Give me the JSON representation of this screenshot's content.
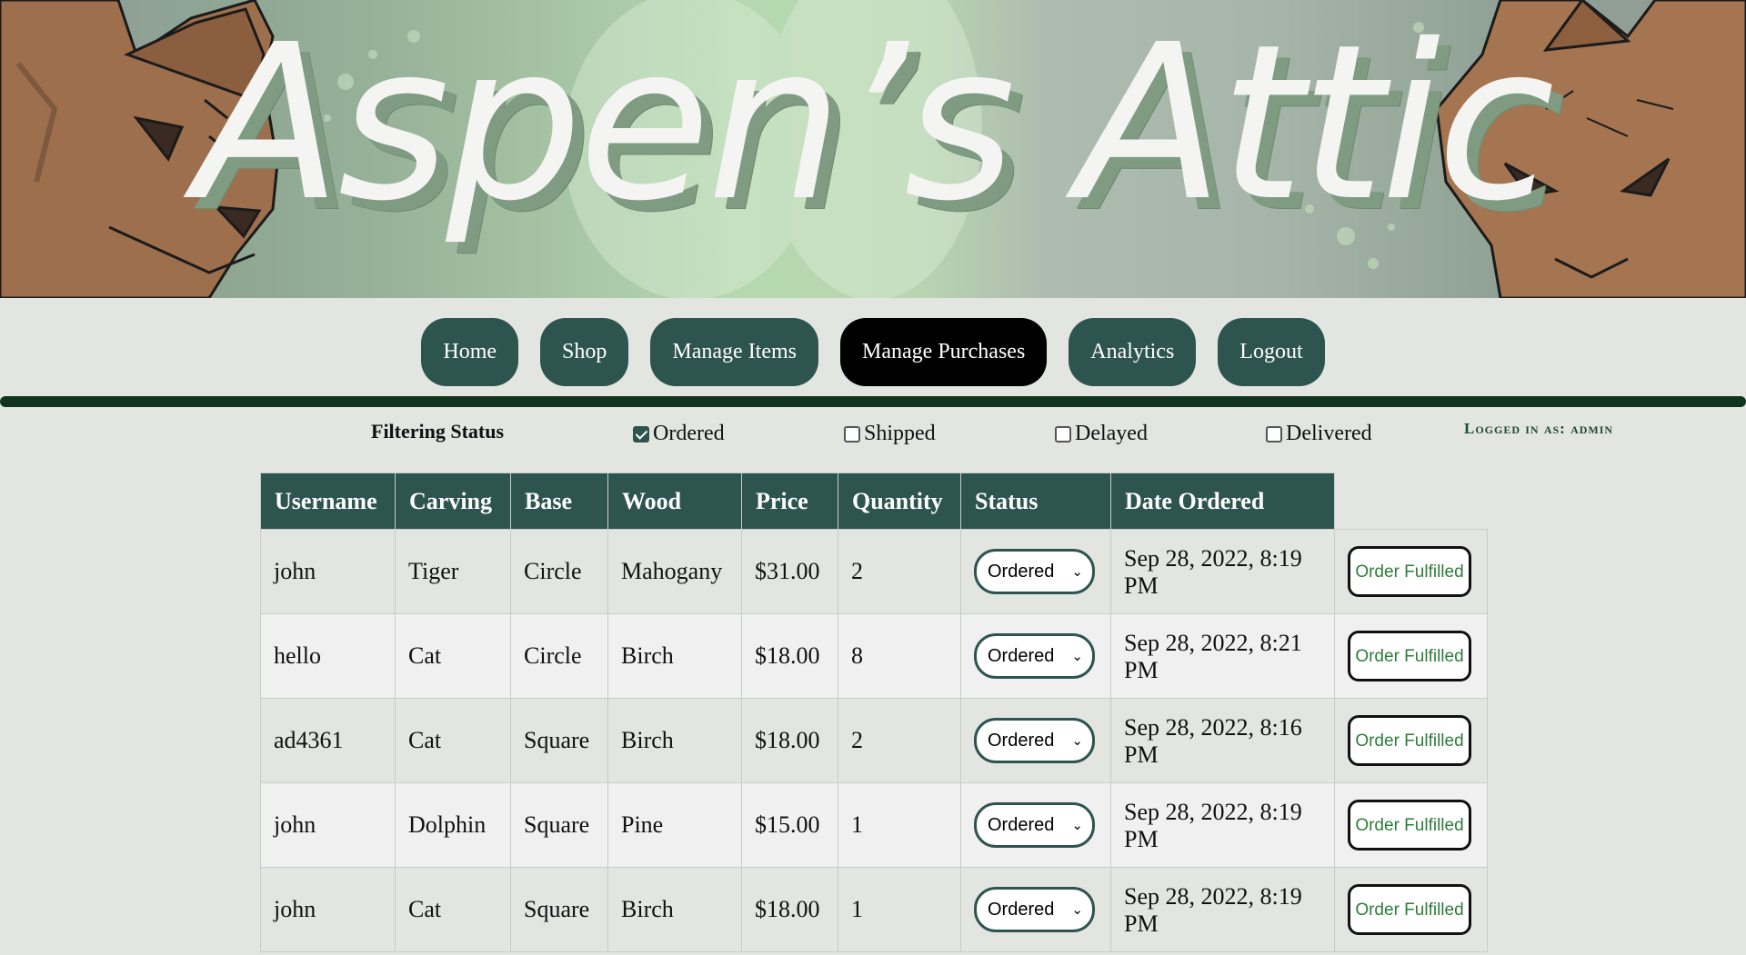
{
  "banner": {
    "title": "Aspen’s Attic"
  },
  "nav": {
    "items": [
      {
        "label": "Home"
      },
      {
        "label": "Shop"
      },
      {
        "label": "Manage Items"
      },
      {
        "label": "Manage Purchases",
        "active": true
      },
      {
        "label": "Analytics"
      },
      {
        "label": "Logout"
      }
    ]
  },
  "filter": {
    "label": "Filtering Status",
    "options": [
      {
        "label": "Ordered",
        "checked": true
      },
      {
        "label": "Shipped",
        "checked": false
      },
      {
        "label": "Delayed",
        "checked": false
      },
      {
        "label": "Delivered",
        "checked": false
      }
    ]
  },
  "user": {
    "logged_in": "Logged in as: admin"
  },
  "table": {
    "headers": [
      "Username",
      "Carving",
      "Base",
      "Wood",
      "Price",
      "Quantity",
      "Status",
      "Date Ordered"
    ],
    "action_label": "Order Fulfilled",
    "rows": [
      {
        "username": "john",
        "carving": "Tiger",
        "base": "Circle",
        "wood": "Mahogany",
        "price": "$31.00",
        "quantity": "2",
        "status": "Ordered",
        "date_line1": "Sep 28, 2022, 8:19",
        "date_line2": "PM"
      },
      {
        "username": "hello",
        "carving": "Cat",
        "base": "Circle",
        "wood": "Birch",
        "price": "$18.00",
        "quantity": "8",
        "status": "Ordered",
        "date_line1": "Sep 28, 2022, 8:21",
        "date_line2": "PM"
      },
      {
        "username": "ad4361",
        "carving": "Cat",
        "base": "Square",
        "wood": "Birch",
        "price": "$18.00",
        "quantity": "2",
        "status": "Ordered",
        "date_line1": "Sep 28, 2022, 8:16",
        "date_line2": "PM"
      },
      {
        "username": "john",
        "carving": "Dolphin",
        "base": "Square",
        "wood": "Pine",
        "price": "$15.00",
        "quantity": "1",
        "status": "Ordered",
        "date_line1": "Sep 28, 2022, 8:19",
        "date_line2": "PM"
      },
      {
        "username": "john",
        "carving": "Cat",
        "base": "Square",
        "wood": "Birch",
        "price": "$18.00",
        "quantity": "1",
        "status": "Ordered",
        "date_line1": "Sep 28, 2022, 8:19",
        "date_line2": "PM"
      }
    ]
  }
}
